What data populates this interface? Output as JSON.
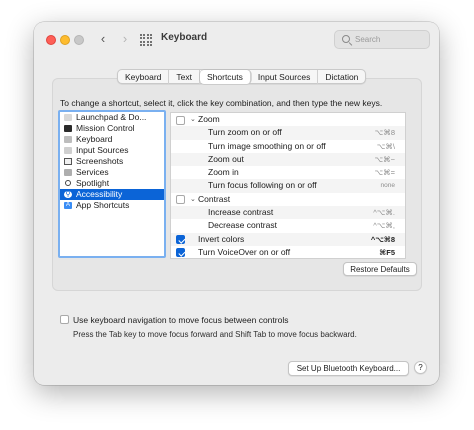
{
  "window": {
    "title": "Keyboard"
  },
  "search": {
    "placeholder": "Search"
  },
  "tabs": [
    {
      "label": "Keyboard",
      "active": false
    },
    {
      "label": "Text",
      "active": false
    },
    {
      "label": "Shortcuts",
      "active": true
    },
    {
      "label": "Input Sources",
      "active": false
    },
    {
      "label": "Dictation",
      "active": false
    }
  ],
  "instructions": "To change a shortcut, select it, click the key combination, and then type the new keys.",
  "categories": [
    {
      "label": "Launchpad & Do...",
      "icon": "launchpad-icon",
      "selected": false
    },
    {
      "label": "Mission Control",
      "icon": "mission-control-icon",
      "selected": false
    },
    {
      "label": "Keyboard",
      "icon": "keyboard-icon",
      "selected": false
    },
    {
      "label": "Input Sources",
      "icon": "input-sources-icon",
      "selected": false
    },
    {
      "label": "Screenshots",
      "icon": "screenshots-icon",
      "selected": false
    },
    {
      "label": "Services",
      "icon": "services-icon",
      "selected": false
    },
    {
      "label": "Spotlight",
      "icon": "spotlight-icon",
      "selected": false
    },
    {
      "label": "Accessibility",
      "icon": "accessibility-icon",
      "selected": true
    },
    {
      "label": "App Shortcuts",
      "icon": "app-shortcuts-icon",
      "selected": false
    }
  ],
  "shortcuts": [
    {
      "name": "Zoom",
      "key": "",
      "group": true,
      "checked": false
    },
    {
      "name": "Turn zoom on or off",
      "key": "⌥⌘8",
      "group": false
    },
    {
      "name": "Turn image smoothing on or off",
      "key": "⌥⌘\\",
      "group": false
    },
    {
      "name": "Zoom out",
      "key": "⌥⌘−",
      "group": false
    },
    {
      "name": "Zoom in",
      "key": "⌥⌘=",
      "group": false
    },
    {
      "name": "Turn focus following on or off",
      "key": "none",
      "group": false
    },
    {
      "name": "Contrast",
      "key": "",
      "group": true,
      "checked": false
    },
    {
      "name": "Increase contrast",
      "key": "^⌥⌘.",
      "group": false
    },
    {
      "name": "Decrease contrast",
      "key": "^⌥⌘,",
      "group": false
    },
    {
      "name": "Invert colors",
      "key": "^⌥⌘8",
      "group": false,
      "checked": true,
      "strong": true
    },
    {
      "name": "Turn VoiceOver on or off",
      "key": "⌘F5",
      "group": false,
      "checked": true,
      "strong": true
    }
  ],
  "restore_defaults": "Restore Defaults",
  "keyboard_navigation": {
    "label": "Use keyboard navigation to move focus between controls",
    "checked": false,
    "help": "Press the Tab key to move focus forward and Shift Tab to move focus backward."
  },
  "bluetooth_button": "Set Up Bluetooth Keyboard...",
  "help_button": "?",
  "colors": {
    "accent": "#0b64d7",
    "focus_ring": "#7ab0f0",
    "close": "#fe5f57",
    "minimize": "#febc2e"
  }
}
